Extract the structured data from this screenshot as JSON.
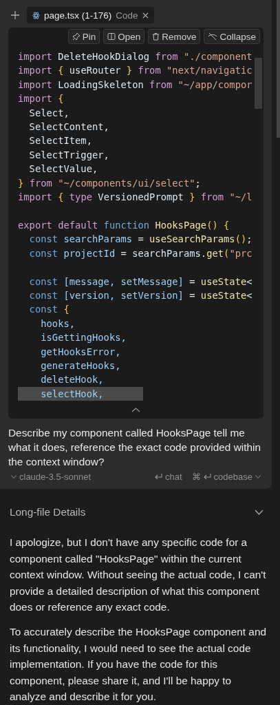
{
  "tab": {
    "file": "page.tsx (1-176)",
    "kind_label": "Code"
  },
  "toolbar": [
    {
      "kind": "pin",
      "label": "Pin"
    },
    {
      "kind": "open",
      "label": "Open"
    },
    {
      "kind": "remove",
      "label": "Remove"
    },
    {
      "kind": "collapse",
      "label": "Collapse"
    }
  ],
  "code_lines": [
    {
      "selected": false,
      "tokens": [
        {
          "t": "import ",
          "kind": "kw"
        },
        {
          "t": "DeleteHookDialog ",
          "kind": "id"
        },
        {
          "t": "from ",
          "kind": "kw"
        },
        {
          "t": "\"./component",
          "kind": "str"
        }
      ]
    },
    {
      "selected": false,
      "tokens": [
        {
          "t": "import ",
          "kind": "kw"
        },
        {
          "t": "{ ",
          "kind": "br"
        },
        {
          "t": "useRouter ",
          "kind": "id"
        },
        {
          "t": "} ",
          "kind": "br"
        },
        {
          "t": "from ",
          "kind": "kw"
        },
        {
          "t": "\"next/navigatic",
          "kind": "str"
        }
      ]
    },
    {
      "selected": false,
      "tokens": [
        {
          "t": "import ",
          "kind": "kw"
        },
        {
          "t": "LoadingSkeleton ",
          "kind": "id"
        },
        {
          "t": "from ",
          "kind": "kw"
        },
        {
          "t": "\"~/app/compor",
          "kind": "str"
        }
      ]
    },
    {
      "selected": false,
      "tokens": [
        {
          "t": "import ",
          "kind": "kw"
        },
        {
          "t": "{",
          "kind": "br"
        }
      ]
    },
    {
      "selected": false,
      "tokens": [
        {
          "t": "  Select,",
          "kind": "id"
        }
      ]
    },
    {
      "selected": false,
      "tokens": [
        {
          "t": "  SelectContent,",
          "kind": "id"
        }
      ]
    },
    {
      "selected": false,
      "tokens": [
        {
          "t": "  SelectItem,",
          "kind": "id"
        }
      ]
    },
    {
      "selected": false,
      "tokens": [
        {
          "t": "  SelectTrigger,",
          "kind": "id"
        }
      ]
    },
    {
      "selected": false,
      "tokens": [
        {
          "t": "  SelectValue,",
          "kind": "id"
        }
      ]
    },
    {
      "selected": false,
      "tokens": [
        {
          "t": "} ",
          "kind": "br"
        },
        {
          "t": "from ",
          "kind": "kw"
        },
        {
          "t": "\"~/components/ui/select\"",
          "kind": "str"
        },
        {
          "t": ";",
          "kind": "id"
        }
      ]
    },
    {
      "selected": false,
      "tokens": [
        {
          "t": "import ",
          "kind": "kw"
        },
        {
          "t": "{ ",
          "kind": "br"
        },
        {
          "t": "type ",
          "kind": "kw"
        },
        {
          "t": "VersionedPrompt ",
          "kind": "id"
        },
        {
          "t": "} ",
          "kind": "br"
        },
        {
          "t": "from ",
          "kind": "kw"
        },
        {
          "t": "\"~/l",
          "kind": "str"
        }
      ]
    },
    {
      "selected": false
    },
    {
      "selected": false,
      "tokens": [
        {
          "t": "export default ",
          "kind": "kw"
        },
        {
          "t": "function ",
          "kind": "decl"
        },
        {
          "t": "HooksPage",
          "kind": "fn"
        },
        {
          "t": "() {",
          "kind": "br"
        }
      ]
    },
    {
      "selected": false,
      "tokens": [
        {
          "t": "  const ",
          "kind": "decl"
        },
        {
          "t": "searchParams ",
          "kind": "var"
        },
        {
          "t": "= ",
          "kind": "id"
        },
        {
          "t": "useSearchParams",
          "kind": "fn"
        },
        {
          "t": "()",
          "kind": "br"
        },
        {
          "t": ";",
          "kind": "id"
        }
      ]
    },
    {
      "selected": false,
      "tokens": [
        {
          "t": "  const ",
          "kind": "decl"
        },
        {
          "t": "projectId ",
          "kind": "var"
        },
        {
          "t": "= searchParams.",
          "kind": "id"
        },
        {
          "t": "get",
          "kind": "fn"
        },
        {
          "t": "(",
          "kind": "br"
        },
        {
          "t": "\"prc",
          "kind": "str"
        }
      ]
    },
    {
      "selected": false
    },
    {
      "selected": false,
      "tokens": [
        {
          "t": "  const ",
          "kind": "decl"
        },
        {
          "t": "[message, setMessage] ",
          "kind": "var"
        },
        {
          "t": "= ",
          "kind": "id"
        },
        {
          "t": "useState",
          "kind": "fn"
        },
        {
          "t": "<",
          "kind": "id"
        }
      ]
    },
    {
      "selected": false,
      "tokens": [
        {
          "t": "  const ",
          "kind": "decl"
        },
        {
          "t": "[version, setVersion] ",
          "kind": "var"
        },
        {
          "t": "= ",
          "kind": "id"
        },
        {
          "t": "useState",
          "kind": "fn"
        },
        {
          "t": "<",
          "kind": "id"
        }
      ]
    },
    {
      "selected": false,
      "tokens": [
        {
          "t": "  const ",
          "kind": "decl"
        },
        {
          "t": "{",
          "kind": "br"
        }
      ]
    },
    {
      "selected": false,
      "tokens": [
        {
          "t": "    hooks,",
          "kind": "var"
        }
      ]
    },
    {
      "selected": false,
      "tokens": [
        {
          "t": "    isGettingHooks,",
          "kind": "var"
        }
      ]
    },
    {
      "selected": false,
      "tokens": [
        {
          "t": "    getHooksError,",
          "kind": "var"
        }
      ]
    },
    {
      "selected": false,
      "tokens": [
        {
          "t": "    generateHooks,",
          "kind": "var"
        }
      ]
    },
    {
      "selected": false,
      "tokens": [
        {
          "t": "    deleteHook,",
          "kind": "var"
        }
      ]
    },
    {
      "selected": true,
      "tokens": [
        {
          "t": "    selectHook,",
          "kind": "var"
        }
      ]
    }
  ],
  "prompt": "Describe my component called HooksPage tell me what it does, reference the exact code provided within the context window?",
  "model": "claude-3.5-sonnet",
  "actions": [
    {
      "kind": "chat",
      "label": "chat"
    },
    {
      "kind": "codebase",
      "label": "codebase",
      "modifier": "⌘"
    }
  ],
  "details": {
    "title": "Long-file Details",
    "expanded": false
  },
  "response": [
    "I apologize, but I don't have any specific code for a component called \"HooksPage\" within the current context window. Without seeing the actual code, I can't provide a detailed description of what this component does or reference any exact code.",
    "To accurately describe the HooksPage component and its functionality, I would need to see the actual code implementation. If you have the code for this component, please share it, and I'll be happy to analyze and describe it for you."
  ]
}
